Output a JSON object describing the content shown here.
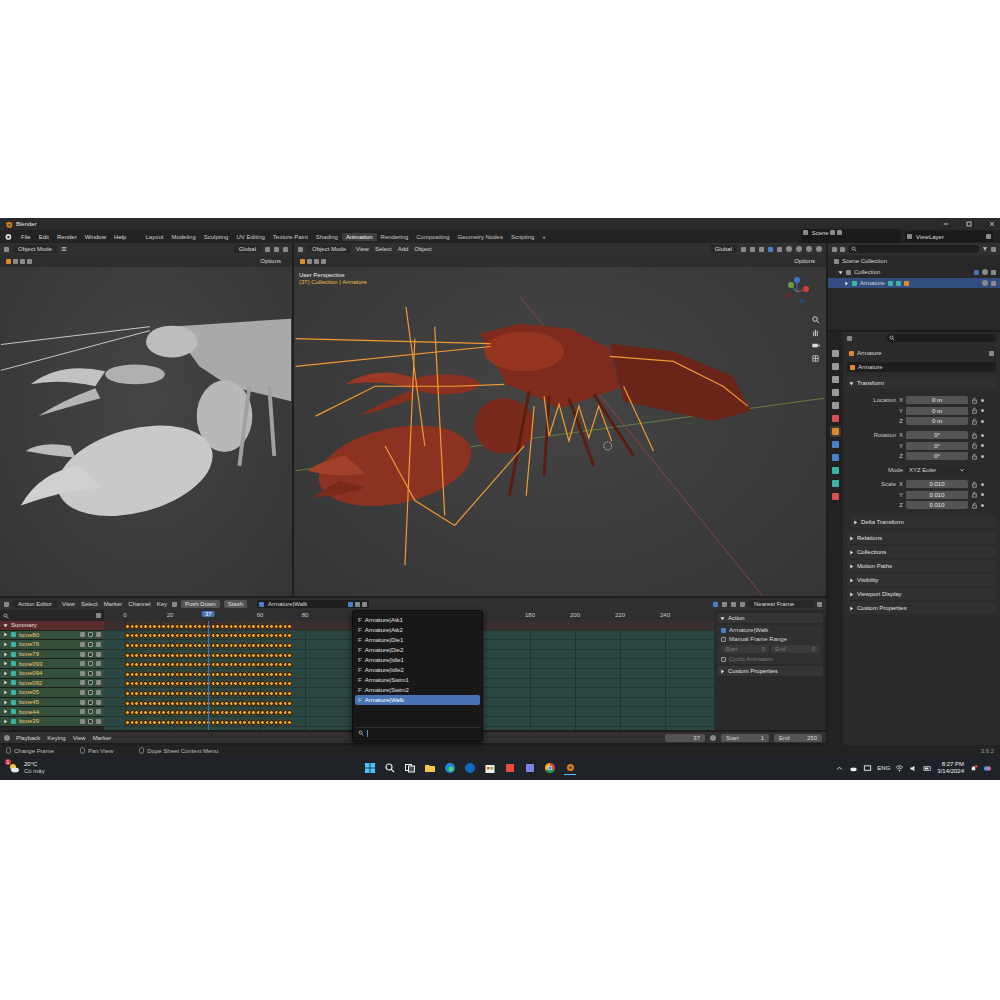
{
  "window": {
    "title": "Blender"
  },
  "menu": [
    "File",
    "Edit",
    "Render",
    "Window",
    "Help"
  ],
  "workspaces": [
    {
      "label": "Layout",
      "selected": false
    },
    {
      "label": "Modeling",
      "selected": false
    },
    {
      "label": "Sculpting",
      "selected": false
    },
    {
      "label": "UV Editing",
      "selected": false
    },
    {
      "label": "Texture Paint",
      "selected": false
    },
    {
      "label": "Shading",
      "selected": false
    },
    {
      "label": "Animation",
      "selected": true
    },
    {
      "label": "Rendering",
      "selected": false
    },
    {
      "label": "Compositing",
      "selected": false
    },
    {
      "label": "Geometry Nodes",
      "selected": false
    },
    {
      "label": "Scripting",
      "selected": false
    }
  ],
  "add_workspace": "+",
  "scene": "Scene",
  "view_layer": "ViewLayer",
  "viewport_left": {
    "mode": "Object Mode",
    "orientation": "Global",
    "options": "Options"
  },
  "viewport_main": {
    "mode": "Object Mode",
    "menu": [
      "View",
      "Select",
      "Add",
      "Object"
    ],
    "orientation": "Global",
    "options": "Options",
    "title": "User Perspective",
    "subtitle": "(37) Collection | Armature"
  },
  "dopesheet": {
    "mode": "Action Editor",
    "menu": [
      "View",
      "Select",
      "Marker",
      "Channel",
      "Key"
    ],
    "push_down": "Push Down",
    "stash": "Stash",
    "action": "Armature|Walk",
    "snap": "Nearest Frame",
    "ticks": [
      "0",
      "20",
      "60",
      "80",
      "180",
      "200",
      "220",
      "240"
    ],
    "current_frame": "37",
    "keys": {
      "first": 0,
      "last": 72,
      "step": 2
    },
    "channels": [
      {
        "name": "Summary",
        "kind": "summary",
        "expanded": true,
        "keys_selected": true
      },
      {
        "name": "bone80",
        "kind": "bone",
        "expanded": false,
        "keys_selected": true
      },
      {
        "name": "bone78",
        "kind": "bone",
        "expanded": false,
        "keys_selected": true
      },
      {
        "name": "bone79",
        "kind": "bone",
        "expanded": false,
        "keys_selected": true
      },
      {
        "name": "bone093",
        "kind": "bone",
        "expanded": false,
        "keys_selected": true
      },
      {
        "name": "bone094",
        "kind": "bone",
        "expanded": false,
        "keys_selected": true
      },
      {
        "name": "bone092",
        "kind": "bone",
        "expanded": false,
        "keys_selected": true
      },
      {
        "name": "bone05",
        "kind": "bone",
        "expanded": false,
        "keys_selected": true
      },
      {
        "name": "bone45",
        "kind": "bone",
        "expanded": false,
        "keys_selected": true
      },
      {
        "name": "bone44",
        "kind": "bone",
        "expanded": false,
        "keys_selected": true
      },
      {
        "name": "bone39",
        "kind": "bone",
        "expanded": false,
        "keys_selected": true
      }
    ]
  },
  "action_menu": {
    "items": [
      {
        "flag": "F",
        "label": "Armature|Atk1",
        "selected": false
      },
      {
        "flag": "F",
        "label": "Armature|Atk2",
        "selected": false
      },
      {
        "flag": "F",
        "label": "Armature|Die1",
        "selected": false
      },
      {
        "flag": "F",
        "label": "Armature|Die2",
        "selected": false
      },
      {
        "flag": "F",
        "label": "Armature|Idle1",
        "selected": false
      },
      {
        "flag": "F",
        "label": "Armature|Idle2",
        "selected": false
      },
      {
        "flag": "F",
        "label": "Armature|Swim1",
        "selected": false
      },
      {
        "flag": "F",
        "label": "Armature|Swim2",
        "selected": false
      },
      {
        "flag": "F",
        "label": "Armature|Walk",
        "selected": true
      }
    ],
    "search": ""
  },
  "action_panel": {
    "title": "Action",
    "action": "Armature|Walk",
    "manual_range": {
      "label": "Manual Frame Range",
      "checked": false
    },
    "start_label": "Start",
    "start": "0",
    "end_label": "End",
    "end": "0",
    "cyclic": {
      "label": "Cyclic Animation",
      "checked": false,
      "disabled": true
    },
    "custom": "Custom Properties"
  },
  "timeline": {
    "menu": [
      "Playback",
      "Keying",
      "View",
      "Marker"
    ],
    "frame": "37",
    "start_label": "Start",
    "start": "1",
    "end_label": "End",
    "end": "250"
  },
  "outliner": {
    "root": "Scene Collection",
    "collections": [
      {
        "label": "Collection",
        "expanded": true,
        "objects": [
          {
            "label": "Armature",
            "selected": true
          }
        ]
      }
    ]
  },
  "properties": {
    "object": "Armature",
    "name": "Armature",
    "transform": {
      "title": "Transform",
      "expanded": true,
      "groups": [
        {
          "kind": "vector",
          "label": "Location",
          "rows": [
            {
              "axis": "X",
              "value": "0 m"
            },
            {
              "axis": "Y",
              "value": "0 m"
            },
            {
              "axis": "Z",
              "value": "0 m"
            }
          ]
        },
        {
          "kind": "vector",
          "label": "Rotation",
          "rows": [
            {
              "axis": "X",
              "value": "0°"
            },
            {
              "axis": "Y",
              "value": "0°"
            },
            {
              "axis": "Z",
              "value": "0°"
            }
          ]
        },
        {
          "kind": "enum",
          "label": "Mode",
          "value": "XYZ Euler"
        },
        {
          "kind": "vector",
          "label": "Scale",
          "rows": [
            {
              "axis": "X",
              "value": "0.010"
            },
            {
              "axis": "Y",
              "value": "0.010"
            },
            {
              "axis": "Z",
              "value": "0.010"
            }
          ]
        }
      ]
    },
    "panels": [
      {
        "label": "Delta Transform",
        "expanded": false
      },
      {
        "label": "Relations",
        "expanded": false
      },
      {
        "label": "Collections",
        "expanded": false
      },
      {
        "label": "Motion Paths",
        "expanded": false
      },
      {
        "label": "Visibility",
        "expanded": false
      },
      {
        "label": "Viewport Display",
        "expanded": false
      },
      {
        "label": "Custom Properties",
        "expanded": false
      }
    ]
  },
  "status_bar": {
    "hints": [
      "Change Frame",
      "Pan View",
      "Dope Sheet Context Menu"
    ],
    "version": "3.6.2"
  },
  "taskbar": {
    "weather": {
      "temp": "20°C",
      "desc": "Có mây",
      "badge": "1"
    },
    "lang": "ENG",
    "time": "8:27 PM",
    "date": "3/14/2024"
  }
}
